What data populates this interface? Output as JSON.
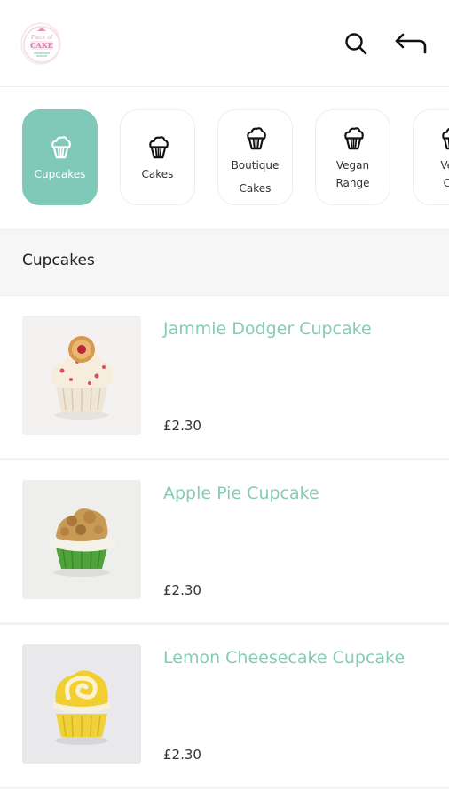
{
  "header": {
    "logo_text": [
      "Piece of",
      "CAKE"
    ],
    "icons": {
      "search": "search-icon",
      "back": "back-arrow-icon"
    }
  },
  "categories": [
    {
      "label": "Cupcakes",
      "icon": "cupcake-icon",
      "active": true
    },
    {
      "label": "Cakes",
      "icon": "cupcake-icon",
      "active": false
    },
    {
      "label_lines": [
        "Boutique",
        "Cakes"
      ],
      "icon": "cupcake-icon",
      "active": false
    },
    {
      "label_lines": [
        "Vegan",
        "Range"
      ],
      "icon": "cupcake-icon",
      "active": false
    },
    {
      "label_lines": [
        "Veg",
        "Ca"
      ],
      "icon": "cupcake-icon",
      "active": false
    }
  ],
  "section": {
    "title": "Cupcakes"
  },
  "products": [
    {
      "name": "Jammie Dodger Cupcake",
      "price": "£2.30"
    },
    {
      "name": "Apple Pie Cupcake",
      "price": "£2.30"
    },
    {
      "name": "Lemon Cheesecake Cupcake",
      "price": "£2.30"
    }
  ],
  "colors": {
    "accent": "#80c9b8",
    "product_name": "#86cbb9",
    "section_bg": "#f6f6f6"
  }
}
